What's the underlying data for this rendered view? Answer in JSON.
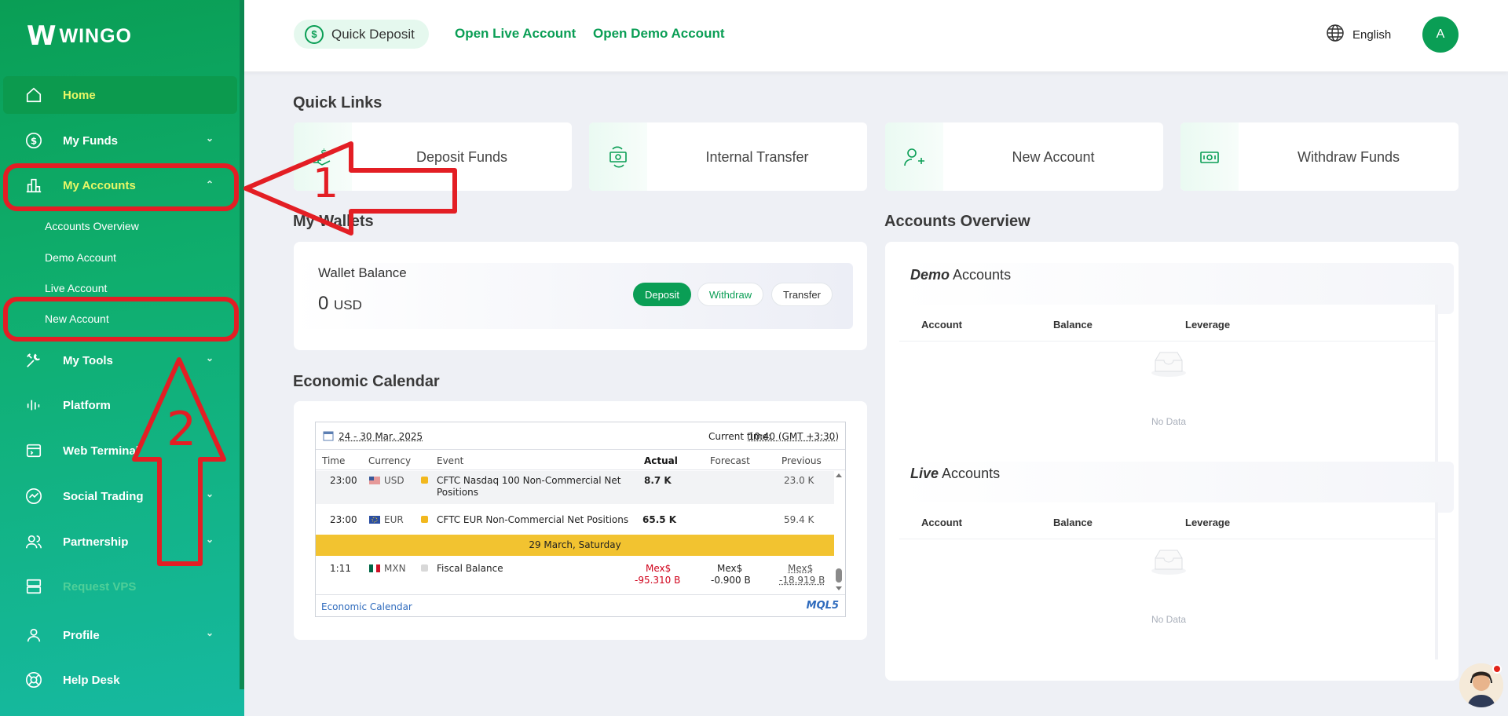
{
  "brand": {
    "logo_text": "WINGO",
    "logo_mark": "W"
  },
  "sidebar": {
    "items": [
      {
        "label": "Home",
        "icon": "home-icon"
      },
      {
        "label": "My Funds",
        "icon": "dollar-circle-icon"
      },
      {
        "label": "My Accounts",
        "icon": "bar-chart-icon"
      },
      {
        "label": "My Tools",
        "icon": "tools-icon"
      },
      {
        "label": "Platform",
        "icon": "equalizer-icon"
      },
      {
        "label": "Web Terminal",
        "icon": "terminal-icon"
      },
      {
        "label": "Social Trading",
        "icon": "trend-icon"
      },
      {
        "label": "Partnership",
        "icon": "people-icon"
      },
      {
        "label": "Request VPS",
        "icon": "server-icon"
      },
      {
        "label": "Profile",
        "icon": "user-icon"
      },
      {
        "label": "Help Desk",
        "icon": "lifebuoy-icon"
      }
    ],
    "sub_items": [
      "Accounts Overview",
      "Demo Account",
      "Live Account",
      "New Account"
    ]
  },
  "header": {
    "quick_deposit": "Quick Deposit",
    "open_live": "Open Live Account",
    "open_demo": "Open Demo Account",
    "language": "English",
    "avatar_initial": "A"
  },
  "quick_links": {
    "title": "Quick Links",
    "cards": [
      "Deposit Funds",
      "Internal Transfer",
      "New Account",
      "Withdraw Funds"
    ]
  },
  "wallets": {
    "title": "My Wallets",
    "balance_label": "Wallet Balance",
    "amount": "0",
    "currency": "USD",
    "buttons": {
      "deposit": "Deposit",
      "withdraw": "Withdraw",
      "transfer": "Transfer"
    }
  },
  "calendar": {
    "title": "Economic Calendar",
    "date_range": "24 - 30 Mar, 2025",
    "current_time_label": "Current time:",
    "current_time": "10:40 (GMT +3:30)",
    "columns": [
      "Time",
      "Currency",
      "Event",
      "Actual",
      "Forecast",
      "Previous"
    ],
    "rows": [
      {
        "time": "23:00",
        "currency": "USD",
        "event_line1": "CFTC Nasdaq 100 Non-Commercial Net",
        "event_line2": "Positions",
        "actual": "8.7 K",
        "forecast": "",
        "previous": "23.0 K"
      },
      {
        "time": "23:00",
        "currency": "EUR",
        "event_line1": "CFTC EUR Non-Commercial Net Positions",
        "event_line2": "",
        "actual": "65.5 K",
        "forecast": "",
        "previous": "59.4 K"
      }
    ],
    "day_divider": "29 March, Saturday",
    "last_row": {
      "time": "1:11",
      "currency": "MXN",
      "event": "Fiscal Balance",
      "actual_line1": "Mex$",
      "actual_line2": "-95.310 B",
      "forecast_line1": "Mex$",
      "forecast_line2": "-0.900 B",
      "previous_line1": "Mex$",
      "previous_line2": "-18.919 B"
    },
    "footer_link": "Economic Calendar",
    "footer_brand": "MQL5",
    "colors": {
      "medium_impact": "#f2b81e",
      "low_impact": "#d8d8d8",
      "negative": "#d0021b"
    }
  },
  "accounts_overview": {
    "title": "Accounts Overview",
    "demo": {
      "title_em": "Demo",
      "title_rest": " Accounts",
      "empty": "No Data"
    },
    "live": {
      "title_em": "Live",
      "title_rest": " Accounts",
      "empty": "No Data"
    },
    "columns": [
      "Account",
      "Balance",
      "Leverage"
    ]
  },
  "annotations": {
    "arrow1_label": "1",
    "arrow2_label": "2",
    "color": "#e31e24"
  },
  "colors": {
    "brand_green": "#0a9e55",
    "accent_yellow": "#e8f766"
  }
}
